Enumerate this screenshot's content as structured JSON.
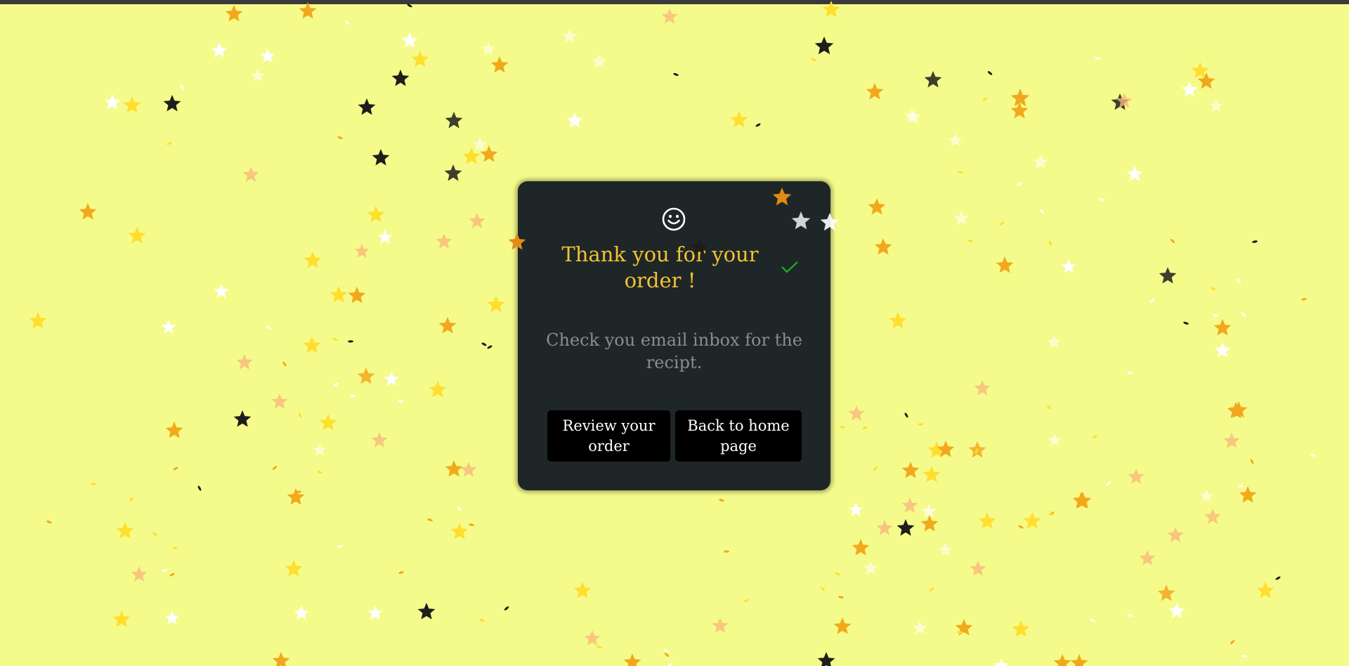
{
  "card": {
    "title": "Thank you for your order !",
    "message": "Check you email inbox for the recipt.",
    "buttons": {
      "review_label": "Review your order",
      "home_label": "Back to home page"
    }
  },
  "colors": {
    "background": "#f5fb8a",
    "card": "#1f2628",
    "title": "#f1c232",
    "message": "#8c8c8c",
    "button": "#000000",
    "button_text": "#ffffff",
    "check": "#1db31d",
    "confetti": [
      "#f2a81d",
      "#ffde2e",
      "#ffffff",
      "#1d1d1b",
      "#f9b97a",
      "#e08c14"
    ]
  },
  "icons": {
    "status": "smiley-icon",
    "confirm": "check-icon",
    "confetti": "star-icon"
  }
}
